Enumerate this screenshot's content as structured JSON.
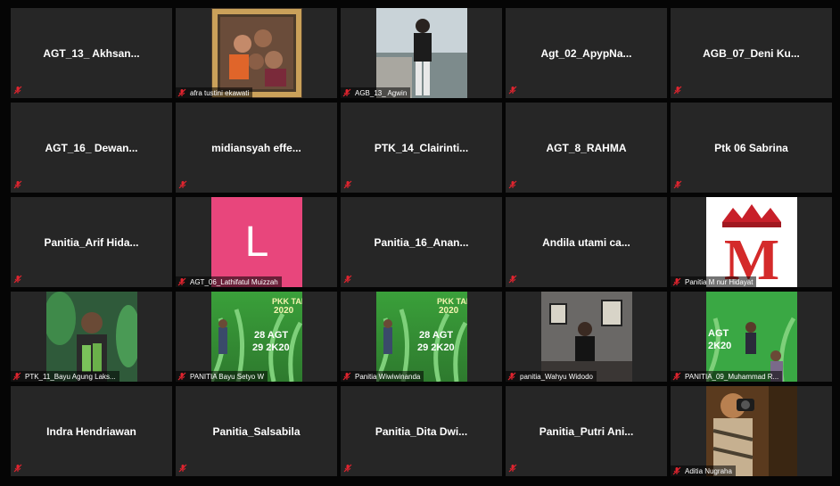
{
  "participants": [
    {
      "name": "AGT_13_ Akhsan...",
      "type": "name"
    },
    {
      "name": "afra tustini ekawati",
      "type": "video",
      "icon": "family-photo-frame"
    },
    {
      "name": "AGB_13_ Agwin",
      "type": "video",
      "icon": "man-by-river"
    },
    {
      "name": "Agt_02_ApypNa...",
      "type": "name"
    },
    {
      "name": "AGB_07_Deni  Ku...",
      "type": "name"
    },
    {
      "name": "AGT_16_ Dewan...",
      "type": "name"
    },
    {
      "name": "midiansyah  effe...",
      "type": "name"
    },
    {
      "name": "PTK_14_Clairinti...",
      "type": "name"
    },
    {
      "name": "AGT_8_RAHMA",
      "type": "name"
    },
    {
      "name": "Ptk 06 Sabrina",
      "type": "name"
    },
    {
      "name": "Panitia_Arif  Hida...",
      "type": "name"
    },
    {
      "name": "AGT_06_Lathifatul Muizzah",
      "type": "letter",
      "letter": "L"
    },
    {
      "name": "Panitia_16_Anan...",
      "type": "name"
    },
    {
      "name": "Andila utami ca...",
      "type": "name"
    },
    {
      "name": "Panitia M nur Hidayat",
      "type": "video",
      "icon": "red-m-crown-logo"
    },
    {
      "name": "PTK_11_Bayu Agung Laks...",
      "type": "video",
      "icon": "man-with-plants"
    },
    {
      "name": "PANITIA Bayu Setyo W",
      "type": "video",
      "icon": "green-event-banner"
    },
    {
      "name": "Panitia Wiwiwinanda",
      "type": "video",
      "icon": "green-event-banner"
    },
    {
      "name": "panitia_Wahyu Widodo",
      "type": "video",
      "icon": "man-in-room"
    },
    {
      "name": "PANITIA_09_Muhammad R...",
      "type": "video",
      "icon": "green-event-banner-2"
    },
    {
      "name": "Indra Hendriawan",
      "type": "name"
    },
    {
      "name": "Panitia_Salsabila",
      "type": "name"
    },
    {
      "name": "Panitia_Dita  Dwi...",
      "type": "name"
    },
    {
      "name": "Panitia_Putri  Ani...",
      "type": "name"
    },
    {
      "name": "Aditia Nugraha",
      "type": "video",
      "icon": "man-with-camera"
    }
  ],
  "banner": {
    "line1": "PKK TANI",
    "line2": "2020",
    "date1": "28 AGT",
    "date2": "29 2K20"
  },
  "logo_letter": "M",
  "colors": {
    "tile": "#262626",
    "muted": "#e0242f",
    "letter_avatar": "#e8467c",
    "banner_green": "#49b64a"
  }
}
